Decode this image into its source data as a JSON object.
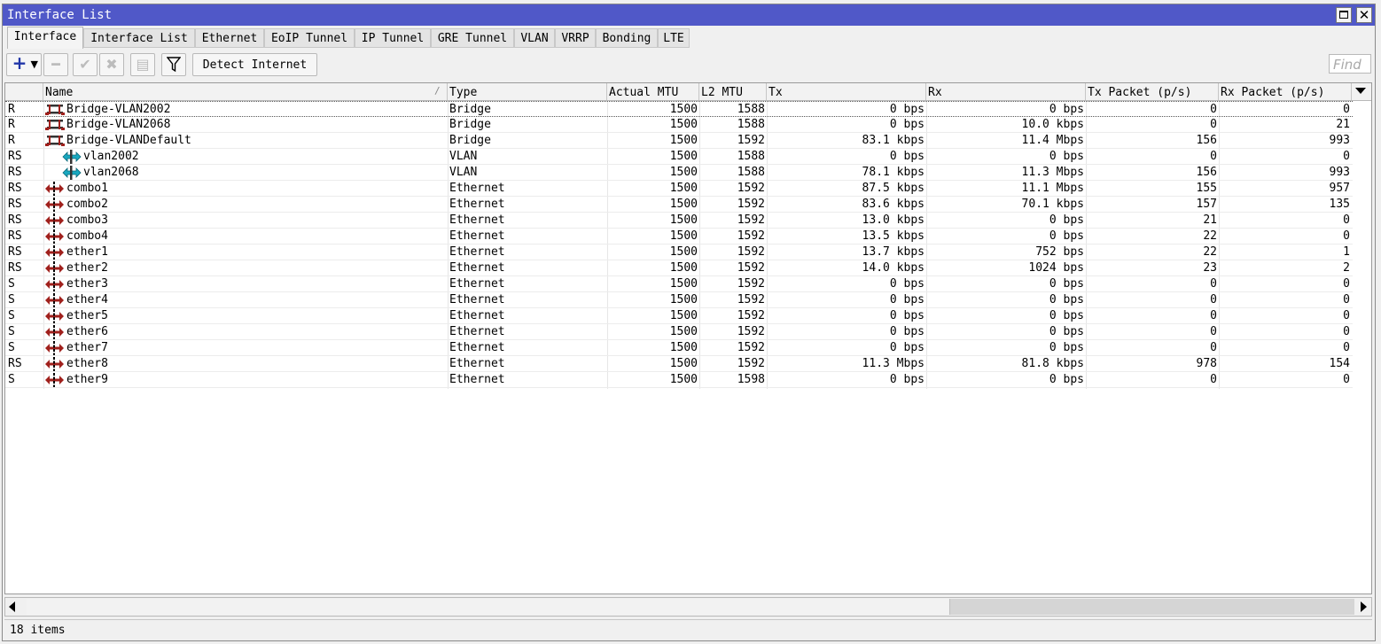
{
  "window": {
    "title": "Interface List"
  },
  "tabs": [
    {
      "label": "Interface",
      "active": true
    },
    {
      "label": "Interface List"
    },
    {
      "label": "Ethernet"
    },
    {
      "label": "EoIP Tunnel"
    },
    {
      "label": "IP Tunnel"
    },
    {
      "label": "GRE Tunnel"
    },
    {
      "label": "VLAN"
    },
    {
      "label": "VRRP"
    },
    {
      "label": "Bonding"
    },
    {
      "label": "LTE"
    }
  ],
  "toolbar": {
    "add_icon": "plus-icon",
    "detect_label": "Detect Internet",
    "find_placeholder": "Find"
  },
  "columns": [
    "",
    "Name",
    "Type",
    "Actual MTU",
    "L2 MTU",
    "Tx",
    "Rx",
    "Tx Packet (p/s)",
    "Rx Packet (p/s)"
  ],
  "rows": [
    {
      "flags": "R",
      "icon": "bridge",
      "indent": false,
      "name": "Bridge-VLAN2002",
      "type": "Bridge",
      "mtu": "1500",
      "l2mtu": "1588",
      "tx": "0 bps",
      "rx": "0 bps",
      "txp": "0",
      "rxp": "0"
    },
    {
      "flags": "R",
      "icon": "bridge",
      "indent": false,
      "name": "Bridge-VLAN2068",
      "type": "Bridge",
      "mtu": "1500",
      "l2mtu": "1588",
      "tx": "0 bps",
      "rx": "10.0 kbps",
      "txp": "0",
      "rxp": "21"
    },
    {
      "flags": "R",
      "icon": "bridge",
      "indent": false,
      "name": "Bridge-VLANDefault",
      "type": "Bridge",
      "mtu": "1500",
      "l2mtu": "1592",
      "tx": "83.1 kbps",
      "rx": "11.4 Mbps",
      "txp": "156",
      "rxp": "993"
    },
    {
      "flags": "RS",
      "icon": "vlan",
      "indent": true,
      "name": "vlan2002",
      "type": "VLAN",
      "mtu": "1500",
      "l2mtu": "1588",
      "tx": "0 bps",
      "rx": "0 bps",
      "txp": "0",
      "rxp": "0"
    },
    {
      "flags": "RS",
      "icon": "vlan",
      "indent": true,
      "name": "vlan2068",
      "type": "VLAN",
      "mtu": "1500",
      "l2mtu": "1588",
      "tx": "78.1 kbps",
      "rx": "11.3 Mbps",
      "txp": "156",
      "rxp": "993"
    },
    {
      "flags": "RS",
      "icon": "ether",
      "indent": false,
      "name": "combo1",
      "type": "Ethernet",
      "mtu": "1500",
      "l2mtu": "1592",
      "tx": "87.5 kbps",
      "rx": "11.1 Mbps",
      "txp": "155",
      "rxp": "957"
    },
    {
      "flags": "RS",
      "icon": "ether",
      "indent": false,
      "name": "combo2",
      "type": "Ethernet",
      "mtu": "1500",
      "l2mtu": "1592",
      "tx": "83.6 kbps",
      "rx": "70.1 kbps",
      "txp": "157",
      "rxp": "135"
    },
    {
      "flags": "RS",
      "icon": "ether",
      "indent": false,
      "name": "combo3",
      "type": "Ethernet",
      "mtu": "1500",
      "l2mtu": "1592",
      "tx": "13.0 kbps",
      "rx": "0 bps",
      "txp": "21",
      "rxp": "0"
    },
    {
      "flags": "RS",
      "icon": "ether",
      "indent": false,
      "name": "combo4",
      "type": "Ethernet",
      "mtu": "1500",
      "l2mtu": "1592",
      "tx": "13.5 kbps",
      "rx": "0 bps",
      "txp": "22",
      "rxp": "0"
    },
    {
      "flags": "RS",
      "icon": "ether",
      "indent": false,
      "name": "ether1",
      "type": "Ethernet",
      "mtu": "1500",
      "l2mtu": "1592",
      "tx": "13.7 kbps",
      "rx": "752 bps",
      "txp": "22",
      "rxp": "1"
    },
    {
      "flags": "RS",
      "icon": "ether",
      "indent": false,
      "name": "ether2",
      "type": "Ethernet",
      "mtu": "1500",
      "l2mtu": "1592",
      "tx": "14.0 kbps",
      "rx": "1024 bps",
      "txp": "23",
      "rxp": "2"
    },
    {
      "flags": "S",
      "icon": "ether",
      "indent": false,
      "name": "ether3",
      "type": "Ethernet",
      "mtu": "1500",
      "l2mtu": "1592",
      "tx": "0 bps",
      "rx": "0 bps",
      "txp": "0",
      "rxp": "0"
    },
    {
      "flags": "S",
      "icon": "ether",
      "indent": false,
      "name": "ether4",
      "type": "Ethernet",
      "mtu": "1500",
      "l2mtu": "1592",
      "tx": "0 bps",
      "rx": "0 bps",
      "txp": "0",
      "rxp": "0"
    },
    {
      "flags": "S",
      "icon": "ether",
      "indent": false,
      "name": "ether5",
      "type": "Ethernet",
      "mtu": "1500",
      "l2mtu": "1592",
      "tx": "0 bps",
      "rx": "0 bps",
      "txp": "0",
      "rxp": "0"
    },
    {
      "flags": "S",
      "icon": "ether",
      "indent": false,
      "name": "ether6",
      "type": "Ethernet",
      "mtu": "1500",
      "l2mtu": "1592",
      "tx": "0 bps",
      "rx": "0 bps",
      "txp": "0",
      "rxp": "0"
    },
    {
      "flags": "S",
      "icon": "ether",
      "indent": false,
      "name": "ether7",
      "type": "Ethernet",
      "mtu": "1500",
      "l2mtu": "1592",
      "tx": "0 bps",
      "rx": "0 bps",
      "txp": "0",
      "rxp": "0"
    },
    {
      "flags": "RS",
      "icon": "ether",
      "indent": false,
      "name": "ether8",
      "type": "Ethernet",
      "mtu": "1500",
      "l2mtu": "1592",
      "tx": "11.3 Mbps",
      "rx": "81.8 kbps",
      "txp": "978",
      "rxp": "154"
    },
    {
      "flags": "S",
      "icon": "ether",
      "indent": false,
      "name": "ether9",
      "type": "Ethernet",
      "mtu": "1500",
      "l2mtu": "1598",
      "tx": "0 bps",
      "rx": "0 bps",
      "txp": "0",
      "rxp": "0"
    }
  ],
  "status": {
    "items_text": "18 items"
  },
  "colors": {
    "titlebar": "#5058c8",
    "accent": "#2035a8",
    "ether_icon": "#a0201c",
    "vlan_icon": "#18a8c0"
  }
}
